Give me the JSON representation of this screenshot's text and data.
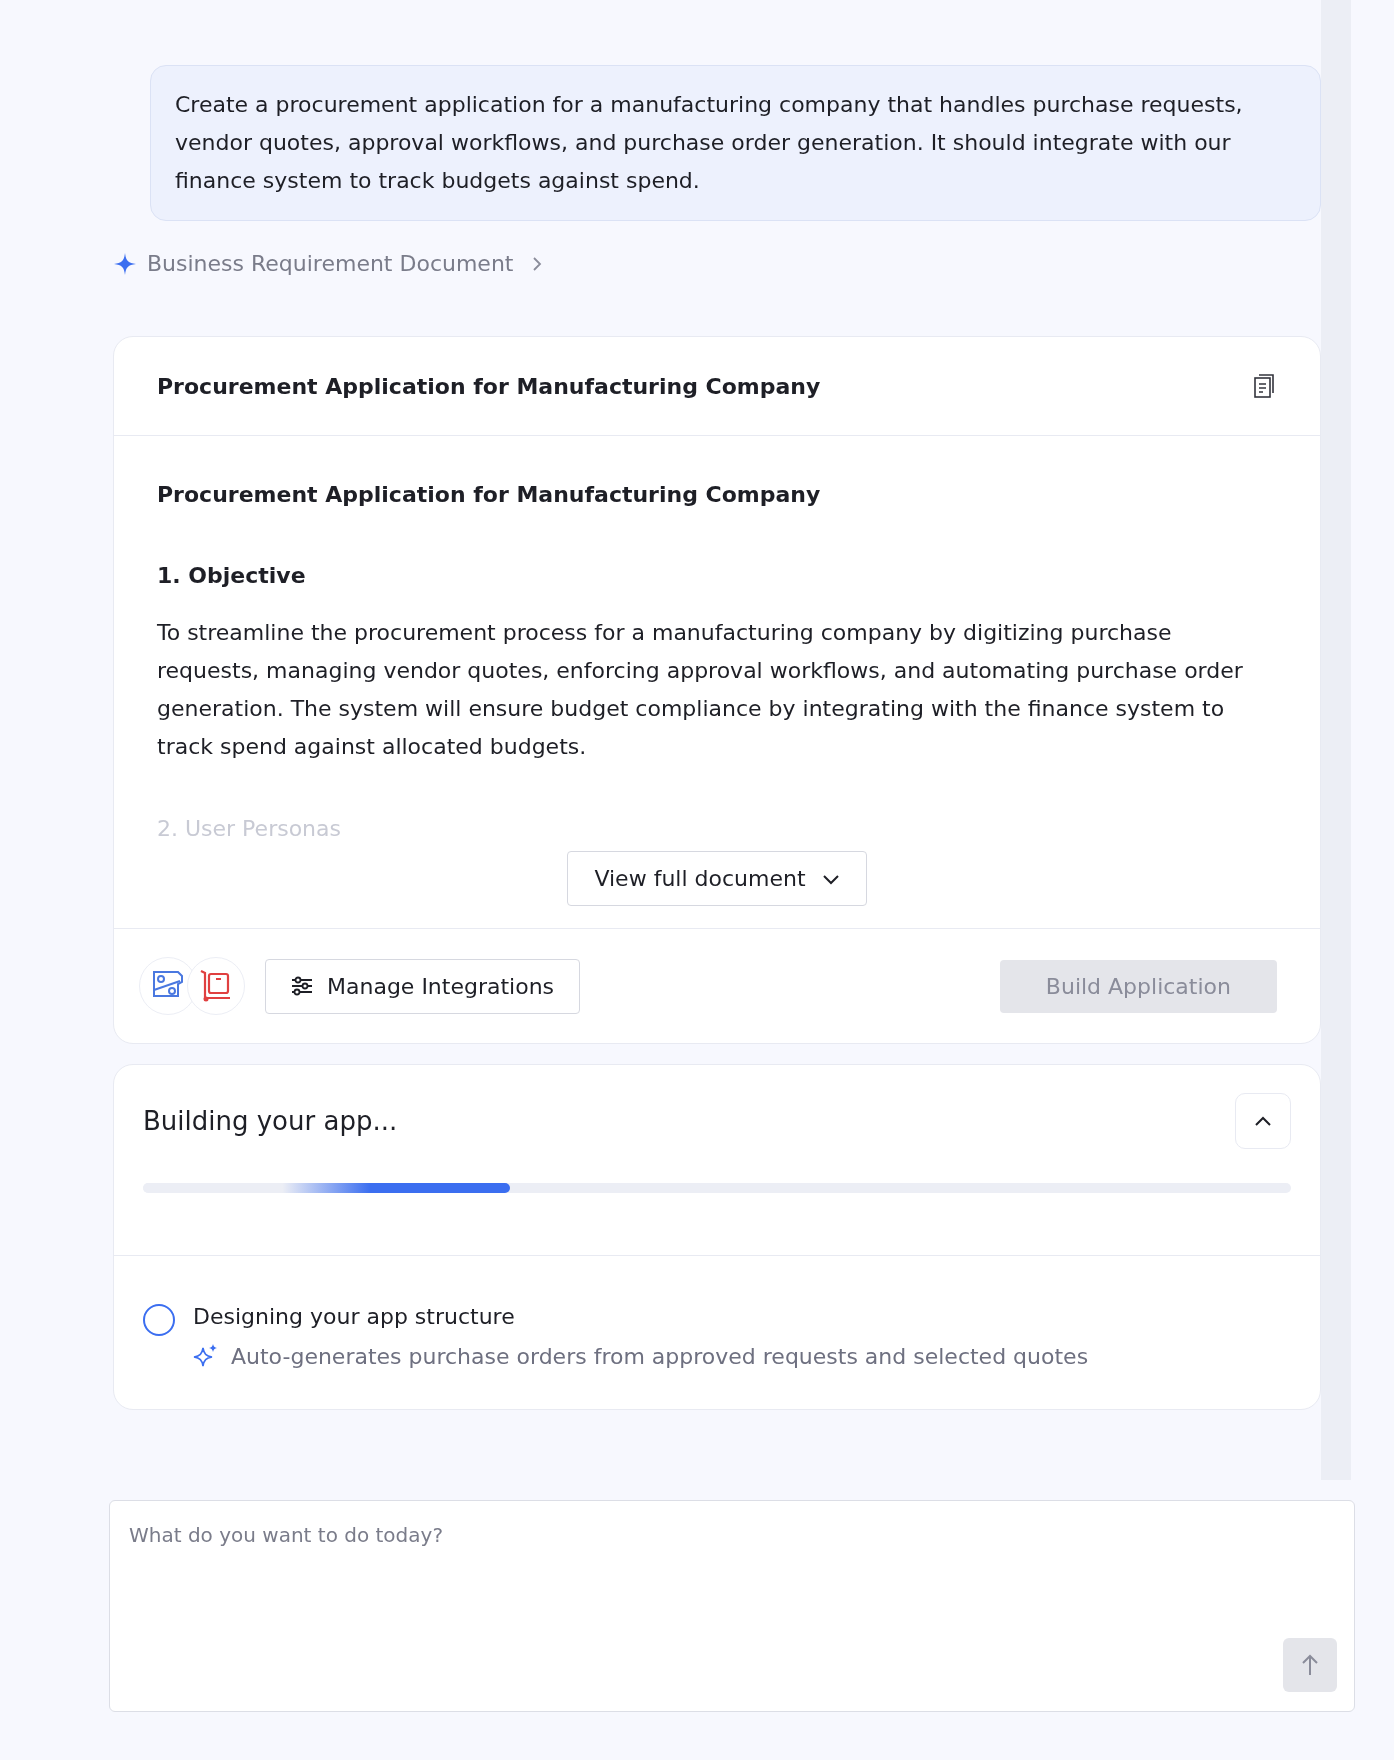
{
  "prompt": {
    "text": "Create a procurement application for a manufacturing company that handles purchase requests, vendor quotes, approval workflows, and purchase order generation. It should integrate with our finance system to track budgets against spend."
  },
  "breadcrumb": {
    "label": "Business Requirement Document"
  },
  "document": {
    "title": "Procurement Application for Manufacturing Company",
    "heading": "Procurement Application for Manufacturing Company",
    "sections": [
      {
        "title": "1. Objective",
        "body": "To streamline the procurement process for a manufacturing company by digitizing purchase requests, managing vendor quotes, enforcing approval workflows, and automating purchase order generation. The system will ensure budget compliance by integrating with the finance system to track spend against allocated budgets.",
        "faded": false
      },
      {
        "title": "2. User Personas",
        "faded": true
      }
    ],
    "view_button": "View full document",
    "manage_button": "Manage Integrations",
    "build_button": {
      "label": "Build Application",
      "disabled": true
    }
  },
  "build": {
    "title": "Building your app...",
    "expanded": true,
    "progress": {
      "level": 0.32
    },
    "steps": [
      {
        "title": "Designing your app structure",
        "detail": "Auto-generates purchase orders from approved requests and selected quotes",
        "done": false
      }
    ]
  },
  "composer": {
    "placeholder": "What do you want to do today?"
  }
}
